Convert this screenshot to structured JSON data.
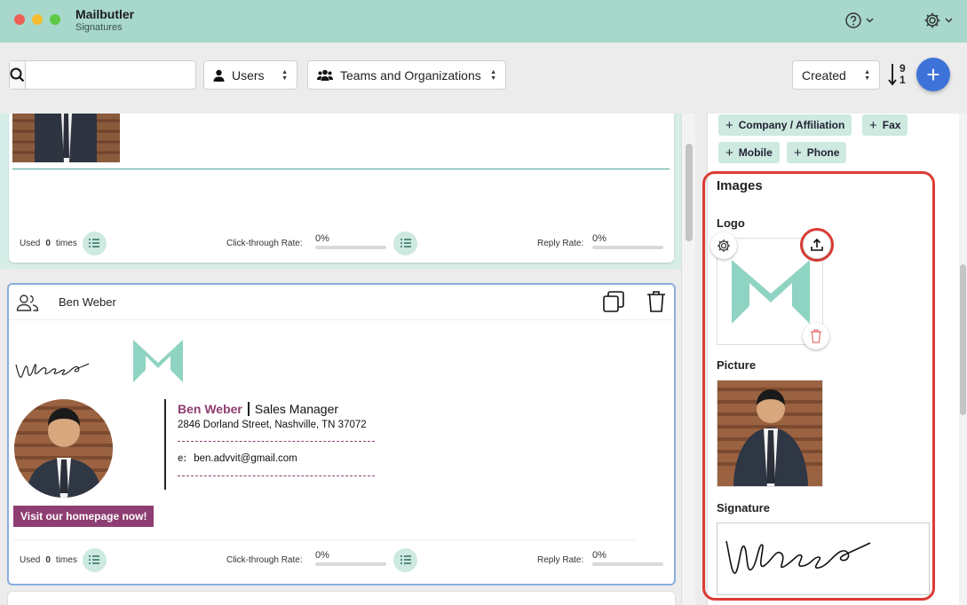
{
  "app": {
    "title": "Mailbutler",
    "subtitle": "Signatures"
  },
  "toolbar": {
    "search_value": "",
    "users_label": "Users",
    "teams_label": "Teams and Organizations",
    "sort_label": "Created",
    "add_label": "+",
    "sort_digits_top": "9",
    "sort_digits_bottom": "1"
  },
  "cards": [
    {
      "stats": {
        "used_prefix": "Used",
        "used_count": "0",
        "used_suffix": "times",
        "ctr_label": "Click-through Rate:",
        "ctr_value": "0%",
        "reply_label": "Reply Rate:",
        "reply_value": "0%"
      }
    },
    {
      "owner": "Ben Weber",
      "signature": {
        "name": "Ben Weber",
        "title": "Sales Manager",
        "address": "2846 Dorland Street, Nashville, TN 37072",
        "email_label": "e:",
        "email": "ben.advvit@gmail.com",
        "cta": "Visit our homepage now!"
      },
      "stats": {
        "used_prefix": "Used",
        "used_count": "0",
        "used_suffix": "times",
        "ctr_label": "Click-through Rate:",
        "ctr_value": "0%",
        "reply_label": "Reply Rate:",
        "reply_value": "0%"
      }
    }
  ],
  "panel": {
    "chips": [
      {
        "label": "Company / Affiliation"
      },
      {
        "label": "Fax"
      },
      {
        "label": "Mobile"
      },
      {
        "label": "Phone"
      }
    ],
    "images_title": "Images",
    "logo_label": "Logo",
    "picture_label": "Picture",
    "signature_label": "Signature"
  },
  "colors": {
    "brand_teal": "#a8d8cb",
    "accent_purple": "#8e3e72",
    "highlight_red": "#dd3b35",
    "add_blue": "#3d73d8"
  }
}
